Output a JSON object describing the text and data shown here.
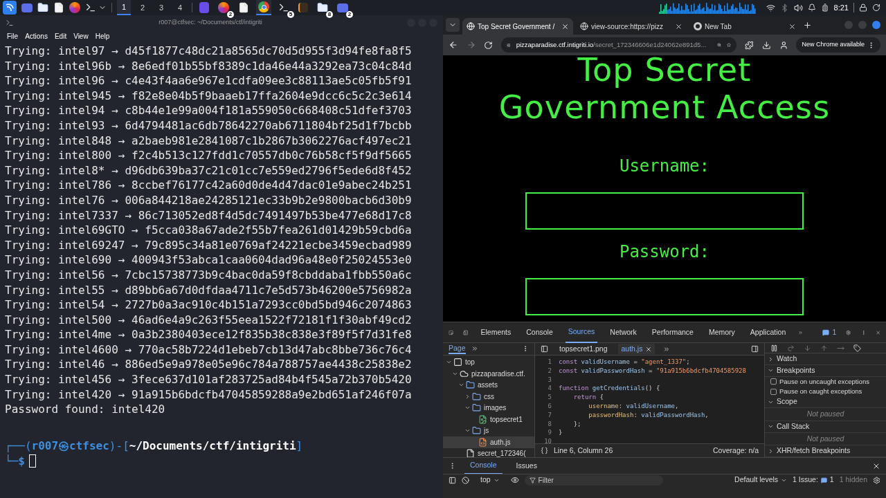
{
  "taskbar": {
    "apps": [
      {
        "kind": "launcher"
      },
      {
        "kind": "desktop"
      },
      {
        "kind": "files"
      },
      {
        "kind": "document"
      },
      {
        "kind": "firefox"
      },
      {
        "kind": "terminal"
      }
    ],
    "workspaces": [
      {
        "label": "1",
        "selected": true
      },
      {
        "label": "2",
        "selected": false
      },
      {
        "label": "3",
        "selected": false
      },
      {
        "label": "4",
        "selected": false
      }
    ],
    "windows": [
      {
        "kind": "editor"
      },
      {
        "kind": "firefox",
        "badge": "2"
      },
      {
        "kind": "document"
      },
      {
        "kind": "chrome",
        "selected": true
      },
      {
        "kind": "terminal",
        "badge": "5"
      },
      {
        "kind": "sublime"
      },
      {
        "kind": "files",
        "badge": "8"
      },
      {
        "kind": "desktop",
        "badge": "2"
      }
    ],
    "clock": "8:21"
  },
  "terminal": {
    "title": "r007@ctfsec: ~/Documents/ctf/intigriti",
    "menu": [
      "File",
      "Actions",
      "Edit",
      "View",
      "Help"
    ],
    "lines": [
      "Trying: intel97 → d45f1877c48dc21a8565dc70d5d955f3d94fe8fa8f5",
      "Trying: intel96b → 8e6edf01b55bf8389c1da46e44a3292ea73c04c84d",
      "Trying: intel96 → c4e43f4aa6e967e1cdfa09ee3c88113ae5c05fb5f91",
      "Trying: intel945 → f82e8e04b5f9baaeb17ffa2604e9dcc6c5c2c3e614",
      "Trying: intel94 → c8b44e1e99a004f181a559050c668408c51dfef3703",
      "Trying: intel93 → 6d4794481ac6db78642270ab6711804bf25d1f7bcbb",
      "Trying: intel848 → a2baeb981e2841087c1b2867b3062276acf497ec21",
      "Trying: intel800 → f2c4b513c127fdd1c70557db0c76b58cf5f9df5665",
      "Trying: intel8* → d96db639ba37c21c01cc7e559ed2796f5ede6d8f452",
      "Trying: intel786 → 8ccbef76177c42a60d0de4d47dac01e9abec24b251",
      "Trying: intel76 → 006a844218ae24285121ec33b9b2e9800bacb6d30b9",
      "Trying: intel7337 → 86c713052ed8f4d5dc7491497b53be477e68d17c8",
      "Trying: intel69GTO → f5cca038a67ade2f55b7fea261d01429b59cbd6a",
      "Trying: intel69247 → 79c895c34a81e0769af24221ecbe3459ecbad989",
      "Trying: intel690 → 400943f53abca1caa0604dad96a48e0f25024553e0",
      "Trying: intel56 → 7cbc15738773b9c4bac0da59f8cbddaba1fbb550a6c",
      "Trying: intel55 → d89bb6a67d0dfdaa4711c7e5d573b46200e5756982a",
      "Trying: intel54 → 2727b0a3ac910c4b151a7293cc0bd5bd946c2074863",
      "Trying: intel500 → 46ad6e4a9c263f55eea1522f72181f1f30abf49cd2",
      "Trying: intel4me → 0a3b2380403ece12f835b38c838e3f89f5f7d31fe8",
      "Trying: intel4600 → 770ac58b7224d1ebeb7cb13d47abc8bbe736c76c4",
      "Trying: intel46 → 886ed5e9a978e05e96c784a788757ae4438c25838e2",
      "Trying: intel456 → 3fece637d101af283725ad84b4f545a72b370b5420",
      "Trying: intel420 → 91a915b6bdcfb47045859288a9e2bd651af246f07a",
      "Password found: intel420"
    ],
    "prompt": {
      "open": "┌──(",
      "user": "r007",
      "at": "㉿",
      "host": "ctfsec",
      "mid": ")-[",
      "path": "~/Documents/ctf/intigriti",
      "close": "]",
      "corner": "└─",
      "symbol": "$"
    }
  },
  "browser": {
    "tabs": [
      {
        "title": "Top Secret Government /",
        "selected": true
      },
      {
        "title": "view-source:https://pizz",
        "selected": false
      },
      {
        "title": "New Tab",
        "selected": false
      }
    ],
    "url": {
      "host": "pizzaparadise.ctf.intigriti.io",
      "path": "/secret_172346606e1d24062e891d5..."
    },
    "update": "New Chrome available",
    "page": {
      "title_lines": [
        "Top Secret",
        "Government Access"
      ],
      "fields": [
        {
          "label": "Username:"
        },
        {
          "label": "Password:"
        }
      ]
    }
  },
  "devtools": {
    "tabs": [
      {
        "label": "Elements",
        "selected": false
      },
      {
        "label": "Console",
        "selected": false
      },
      {
        "label": "Sources",
        "selected": true
      },
      {
        "label": "Network",
        "selected": false
      },
      {
        "label": "Performance",
        "selected": false
      },
      {
        "label": "Memory",
        "selected": false
      },
      {
        "label": "Application",
        "selected": false
      }
    ],
    "issues_count": "1",
    "navigator": {
      "tab": "Page",
      "tree": [
        {
          "kind": "frame",
          "label": "top",
          "expanded": true,
          "selected": false,
          "children": [
            {
              "kind": "domain",
              "label": "pizzaparadise.ctf.",
              "expanded": true,
              "selected": false,
              "children": [
                {
                  "kind": "folder",
                  "label": "assets",
                  "expanded": true,
                  "selected": false,
                  "children": [
                    {
                      "kind": "folder",
                      "label": "css",
                      "expanded": false,
                      "selected": false
                    },
                    {
                      "kind": "folder",
                      "label": "images",
                      "expanded": true,
                      "selected": false,
                      "children": [
                        {
                          "kind": "image",
                          "label": "topsecret1",
                          "selected": false
                        }
                      ]
                    },
                    {
                      "kind": "folder",
                      "label": "js",
                      "expanded": true,
                      "selected": false,
                      "children": [
                        {
                          "kind": "script",
                          "label": "auth.js",
                          "selected": true
                        }
                      ]
                    }
                  ]
                },
                {
                  "kind": "document",
                  "label": "secret_172346(",
                  "selected": false
                }
              ]
            }
          ]
        }
      ]
    },
    "editor": {
      "tabs": [
        {
          "label": "topsecret1.png",
          "selected": false
        },
        {
          "label": "auth.js",
          "selected": true
        }
      ],
      "lines": [
        {
          "number": "1",
          "tokens": [
            {
              "kind": "keyword",
              "text": "const"
            },
            {
              "kind": "name",
              "text": " validUsername "
            },
            {
              "kind": "punct",
              "text": "= "
            },
            {
              "kind": "string",
              "text": "\"agent_1337\""
            },
            {
              "kind": "punct",
              "text": ";"
            }
          ]
        },
        {
          "number": "2",
          "tokens": [
            {
              "kind": "keyword",
              "text": "const"
            },
            {
              "kind": "name",
              "text": " validPasswordHash "
            },
            {
              "kind": "punct",
              "text": "= "
            },
            {
              "kind": "string",
              "text": "\"91a915b6bdcfb4704585928"
            }
          ]
        },
        {
          "number": "3"
        },
        {
          "number": "4",
          "tokens": [
            {
              "kind": "keyword",
              "text": "function"
            },
            {
              "kind": "name",
              "text": " getCredentials"
            },
            {
              "kind": "punct",
              "text": "() {"
            }
          ]
        },
        {
          "number": "5",
          "tokens": [
            {
              "kind": "keyword",
              "text": "    return"
            },
            {
              "kind": "punct",
              "text": " {"
            }
          ]
        },
        {
          "number": "6",
          "tokens": [
            {
              "kind": "property",
              "text": "        username"
            },
            {
              "kind": "punct",
              "text": ": "
            },
            {
              "kind": "name",
              "text": "validUsername"
            },
            {
              "kind": "punct",
              "text": ","
            }
          ]
        },
        {
          "number": "7",
          "tokens": [
            {
              "kind": "property",
              "text": "        passwordHash"
            },
            {
              "kind": "punct",
              "text": ": "
            },
            {
              "kind": "name",
              "text": "validPasswordHash"
            },
            {
              "kind": "punct",
              "text": ","
            }
          ]
        },
        {
          "number": "8",
          "tokens": [
            {
              "kind": "punct",
              "text": "    };"
            }
          ]
        },
        {
          "number": "9",
          "tokens": [
            {
              "kind": "punct",
              "text": "}"
            }
          ]
        },
        {
          "number": "10"
        }
      ],
      "position": "Line 6, Column 26",
      "coverage": "Coverage: n/a"
    },
    "debugger": [
      {
        "kind": "header",
        "label": "Watch",
        "expanded": false
      },
      {
        "kind": "header",
        "label": "Breakpoints",
        "expanded": true
      },
      {
        "kind": "checkbox",
        "label": "Pause on uncaught exceptions",
        "checked": false
      },
      {
        "kind": "checkbox",
        "label": "Pause on caught exceptions",
        "checked": false
      },
      {
        "kind": "header",
        "label": "Scope",
        "expanded": true
      },
      {
        "kind": "note",
        "label": "Not paused"
      },
      {
        "kind": "header",
        "label": "Call Stack",
        "expanded": true
      },
      {
        "kind": "note",
        "label": "Not paused"
      },
      {
        "kind": "header",
        "label": "XHR/fetch Breakpoints",
        "expanded": false
      }
    ],
    "drawer": {
      "tabs": [
        {
          "label": "Console",
          "selected": true
        },
        {
          "label": "Issues",
          "selected": false
        }
      ],
      "context": "top",
      "filter_placeholder": "Filter",
      "levels": "Default levels",
      "issues_label": "1 Issue:",
      "issues_count": "1",
      "hidden": "1 hidden"
    }
  }
}
